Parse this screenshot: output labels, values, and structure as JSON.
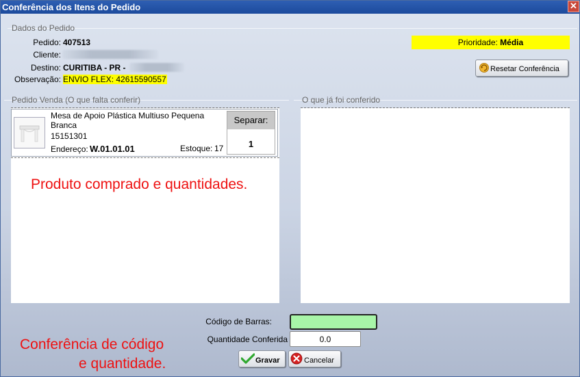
{
  "window": {
    "title": "Conferência dos Itens do Pedido",
    "close_symbol": "✕"
  },
  "order": {
    "legend": "Dados do Pedido",
    "pedido_label": "Pedido:",
    "pedido_value": "407513",
    "cliente_label": "Cliente:",
    "destino_label": "Destino:",
    "destino_value": "CURITIBA - PR -",
    "observacao_label": "Observação:",
    "observacao_value": "ENVIO FLEX: 42615590557",
    "prioridade_label": "Prioridade:",
    "prioridade_value": "Média",
    "reset_label": "Resetar Conferência"
  },
  "pedido_venda": {
    "legend": "Pedido Venda (O que falta conferir)",
    "items": [
      {
        "name_line1": "Mesa de Apoio Plástica Multiuso Pequena",
        "name_line2": "Branca",
        "code": "15151301",
        "endereco_label": "Endereço:",
        "endereco_value": "W.01.01.01",
        "estoque_label": "Estoque:",
        "estoque_value": "17",
        "separar_label": "Separar:",
        "separar_value": "1"
      }
    ],
    "annotation": "Produto comprado e quantidades."
  },
  "conferido": {
    "legend": "O que já foi conferido"
  },
  "form": {
    "barcode_label": "Código de Barras:",
    "barcode_value": "",
    "quantidade_label": "Quantidade Conferida",
    "quantidade_value": "0.0",
    "gravar_label": "Gravar",
    "cancelar_label": "Cancelar",
    "annotation_line1": "Conferência de código",
    "annotation_line2": "e quantidade."
  },
  "colors": {
    "highlight": "#ffff00",
    "barcode_bg": "#a8f5a8",
    "annotation": "#ee1111",
    "titlebar": "#1c4a9c"
  }
}
